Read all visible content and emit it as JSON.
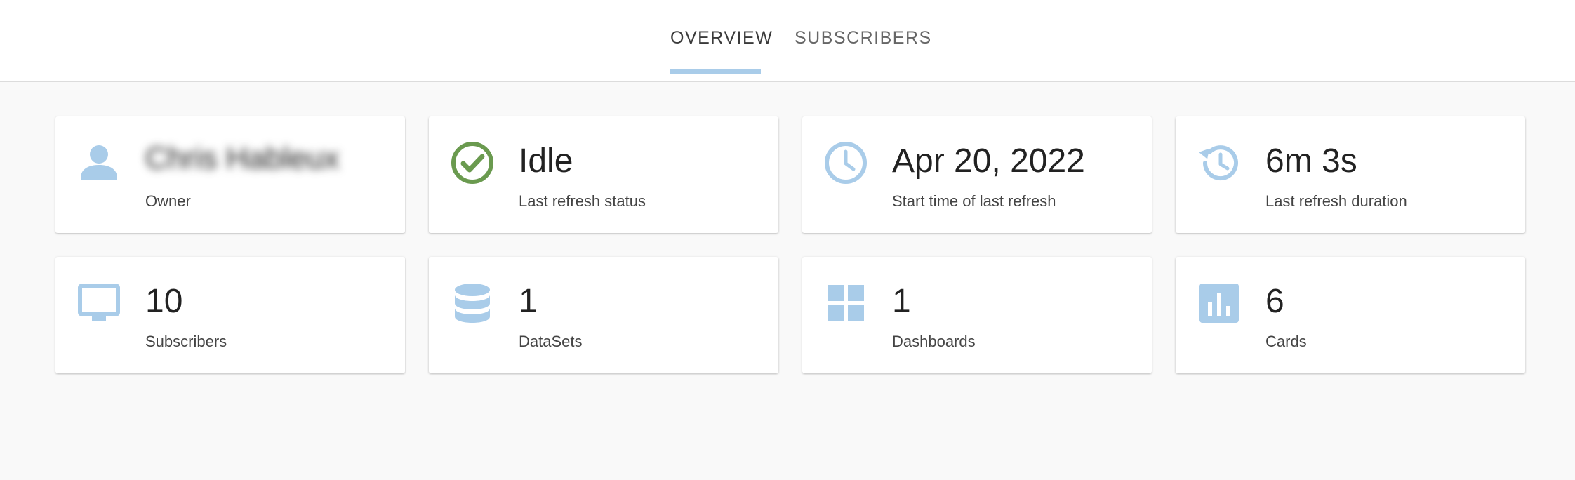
{
  "tabs": [
    {
      "label": "OVERVIEW",
      "active": true
    },
    {
      "label": "SUBSCRIBERS",
      "active": false
    }
  ],
  "colors": {
    "accent": "#a9cce9",
    "success": "#6a9a4f",
    "background": "#f9f9f9",
    "card": "#ffffff"
  },
  "cards": {
    "owner": {
      "value": "Chris Hableux",
      "label": "Owner",
      "icon": "person-icon"
    },
    "status": {
      "value": "Idle",
      "label": "Last refresh status",
      "icon": "check-circle-icon"
    },
    "start": {
      "value": "Apr 20, 2022",
      "label": "Start time of last refresh",
      "icon": "clock-icon"
    },
    "duration": {
      "value": "6m 3s",
      "label": "Last refresh duration",
      "icon": "history-icon"
    },
    "subscribers": {
      "value": "10",
      "label": "Subscribers",
      "icon": "monitor-icon"
    },
    "datasets": {
      "value": "1",
      "label": "DataSets",
      "icon": "database-icon"
    },
    "dashboards": {
      "value": "1",
      "label": "Dashboards",
      "icon": "dashboard-grid-icon"
    },
    "cards_count": {
      "value": "6",
      "label": "Cards",
      "icon": "bar-chart-icon"
    }
  }
}
